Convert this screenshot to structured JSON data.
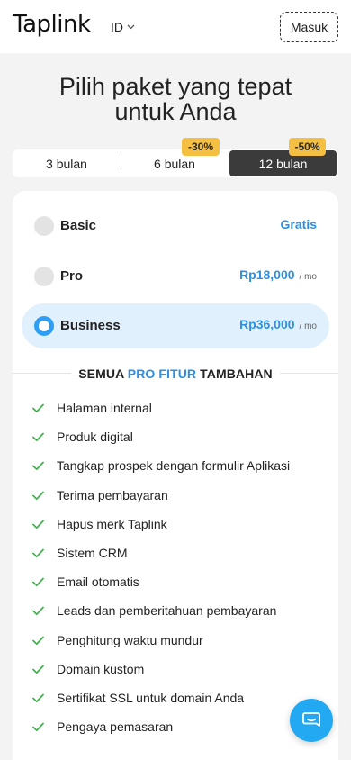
{
  "header": {
    "logo": "Taplink",
    "language": "ID",
    "login_label": "Masuk"
  },
  "title": {
    "line1": "Pilih paket yang tepat",
    "line2": "untuk Anda"
  },
  "periods": [
    {
      "label": "3 bulan",
      "badge": "",
      "selected": false
    },
    {
      "label": "6 bulan",
      "badge": "-30%",
      "selected": false
    },
    {
      "label": "12 bulan",
      "badge": "-50%",
      "selected": true
    }
  ],
  "plans": [
    {
      "name": "Basic",
      "price": "Gratis",
      "unit": "",
      "selected": false
    },
    {
      "name": "Pro",
      "price": "Rp18,000",
      "unit": "/ mo",
      "selected": false
    },
    {
      "name": "Business",
      "price": "Rp36,000",
      "unit": "/ mo",
      "selected": true
    }
  ],
  "features_heading": {
    "before": "SEMUA",
    "accent": "PRO FITUR",
    "after": "TAMBAHAN"
  },
  "features": [
    "Halaman internal",
    "Produk digital",
    "Tangkap prospek dengan formulir Aplikasi",
    "Terima pembayaran",
    "Hapus merk Taplink",
    "Sistem CRM",
    "Email otomatis",
    "Leads dan pemberitahuan pembayaran",
    "Penghitung waktu mundur",
    "Domain kustom",
    "Sertifikat SSL untuk domain Anda",
    "Pengaya pemasaran"
  ],
  "colors": {
    "accent": "#2e8fe0",
    "badge": "#f5c041",
    "check": "#3cb14a",
    "selected_plan_bg": "#e1f0fd",
    "chat_button": "#22a9f2"
  },
  "icons": {
    "language_chevron": "chevron-down-icon",
    "feature_check": "checkmark-icon",
    "chat": "chat-bubble-icon"
  }
}
